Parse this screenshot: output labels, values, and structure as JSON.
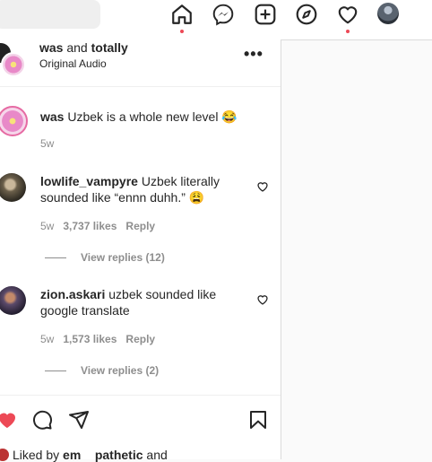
{
  "nav": {
    "icons": [
      "home-icon",
      "messenger-icon",
      "new-post-icon",
      "explore-icon",
      "activity-heart-icon",
      "profile-avatar"
    ]
  },
  "post": {
    "author1": "was",
    "and": " and ",
    "author2": "totally",
    "audio": "Original Audio"
  },
  "comments": [
    {
      "user": "was",
      "text": " Uzbek is a whole new level 😂",
      "time": "5w"
    },
    {
      "user": "lowlife_vampyre",
      "text": " Uzbek literally sounded like “ennn duhh.” 😩",
      "time": "5w",
      "likes": "3,737 likes",
      "reply": "Reply",
      "view_replies": "View replies (12)"
    },
    {
      "user": "zion.askari",
      "text": " uzbek sounded like google translate",
      "time": "5w",
      "likes": "1,573 likes",
      "reply": "Reply",
      "view_replies": "View replies (2)"
    }
  ],
  "liked_by": {
    "prefix": "Liked by ",
    "user1": "em",
    "user2": "pathetic",
    "suffix": " and"
  },
  "colors": {
    "like_red": "#ed4956",
    "muted": "#8e8e8e",
    "text": "#262626"
  }
}
